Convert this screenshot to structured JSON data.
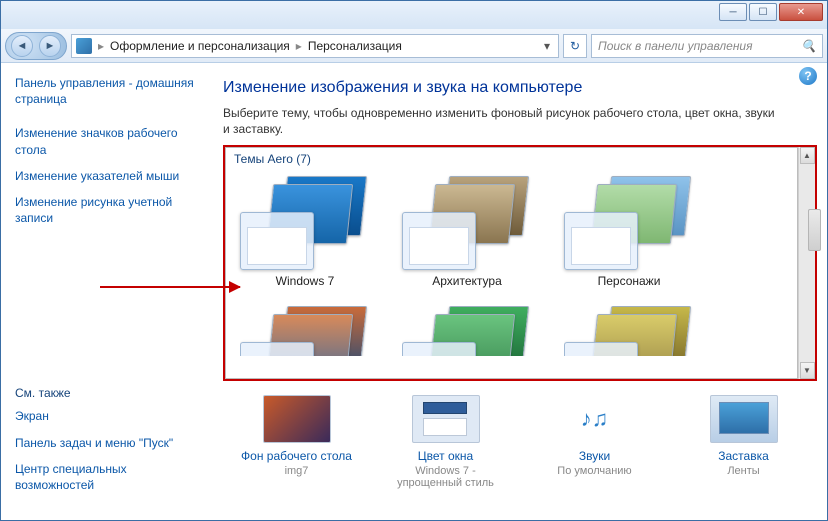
{
  "breadcrumb": {
    "seg1": "Оформление и персонализация",
    "seg2": "Персонализация"
  },
  "search": {
    "placeholder": "Поиск в панели управления"
  },
  "sidebar": {
    "home": "Панель управления - домашняя страница",
    "links": [
      "Изменение значков рабочего стола",
      "Изменение указателей мыши",
      "Изменение рисунка учетной записи"
    ],
    "see_also_hdr": "См. также",
    "see_also": [
      "Экран",
      "Панель задач и меню \"Пуск\"",
      "Центр специальных возможностей"
    ]
  },
  "main": {
    "title": "Изменение изображения и звука на компьютере",
    "subtitle": "Выберите тему, чтобы одновременно изменить фоновый рисунок рабочего стола, цвет окна, звуки и заставку.",
    "group_header": "Темы Aero (7)",
    "themes": [
      "Windows 7",
      "Архитектура",
      "Персонажи"
    ]
  },
  "bottom": [
    {
      "link": "Фон рабочего стола",
      "sub": "img7"
    },
    {
      "link": "Цвет окна",
      "sub": "Windows 7 - упрощенный стиль"
    },
    {
      "link": "Звуки",
      "sub": "По умолчанию"
    },
    {
      "link": "Заставка",
      "sub": "Ленты"
    }
  ],
  "theme_colors": [
    [
      "#1978c8",
      "#0a4e8e"
    ],
    [
      "#b8a27c",
      "#6e5b3a"
    ],
    [
      "#8fc2ea",
      "#5a94c4"
    ]
  ],
  "theme_colors2": [
    [
      "#c96b3a",
      "#3a4e6e"
    ],
    [
      "#3fae5f",
      "#1f6e3a"
    ],
    [
      "#c6b84a",
      "#7e6e2a"
    ]
  ]
}
